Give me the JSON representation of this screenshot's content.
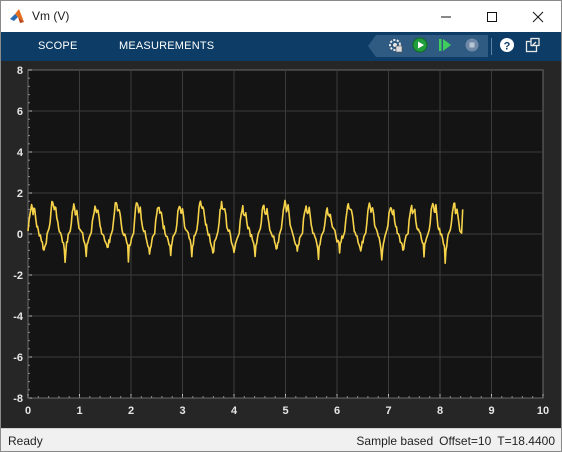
{
  "window": {
    "title": "Vm (V)"
  },
  "toolstrip": {
    "tabs": [
      {
        "label": "SCOPE"
      },
      {
        "label": "MEASUREMENTS"
      }
    ],
    "buttons": [
      "settings-icon",
      "run-icon",
      "step-forward-icon",
      "stop-icon",
      "help-icon",
      "undock-icon"
    ]
  },
  "status": {
    "state": "Ready",
    "mode": "Sample based",
    "offset": "Offset=10",
    "time": "T=18.4400"
  },
  "chart_data": {
    "type": "line",
    "title": "",
    "xlabel": "",
    "ylabel": "",
    "xlim": [
      0,
      10
    ],
    "ylim": [
      -8,
      8
    ],
    "xticks": [
      "0",
      "1",
      "2",
      "3",
      "4",
      "5",
      "6",
      "7",
      "8",
      "9",
      "10"
    ],
    "yticks": [
      "8",
      "6",
      "4",
      "2",
      "0",
      "-2",
      "-4",
      "-6",
      "-8"
    ],
    "grid": true,
    "background": "#141414",
    "line_color": "#f7d34a",
    "x_end": 8.44,
    "period": 0.41,
    "cycle_shape": [
      [
        0.0,
        0.15
      ],
      [
        0.04,
        1.1
      ],
      [
        0.07,
        1.45
      ],
      [
        0.1,
        1.05
      ],
      [
        0.13,
        1.2
      ],
      [
        0.17,
        0.4
      ],
      [
        0.2,
        0.15
      ],
      [
        0.24,
        -0.05
      ],
      [
        0.28,
        -0.45
      ],
      [
        0.31,
        -0.8
      ],
      [
        0.34,
        -0.45
      ],
      [
        0.37,
        -0.1
      ],
      [
        0.41,
        0.15
      ]
    ],
    "series": [
      {
        "values_note_free": true
      }
    ]
  }
}
